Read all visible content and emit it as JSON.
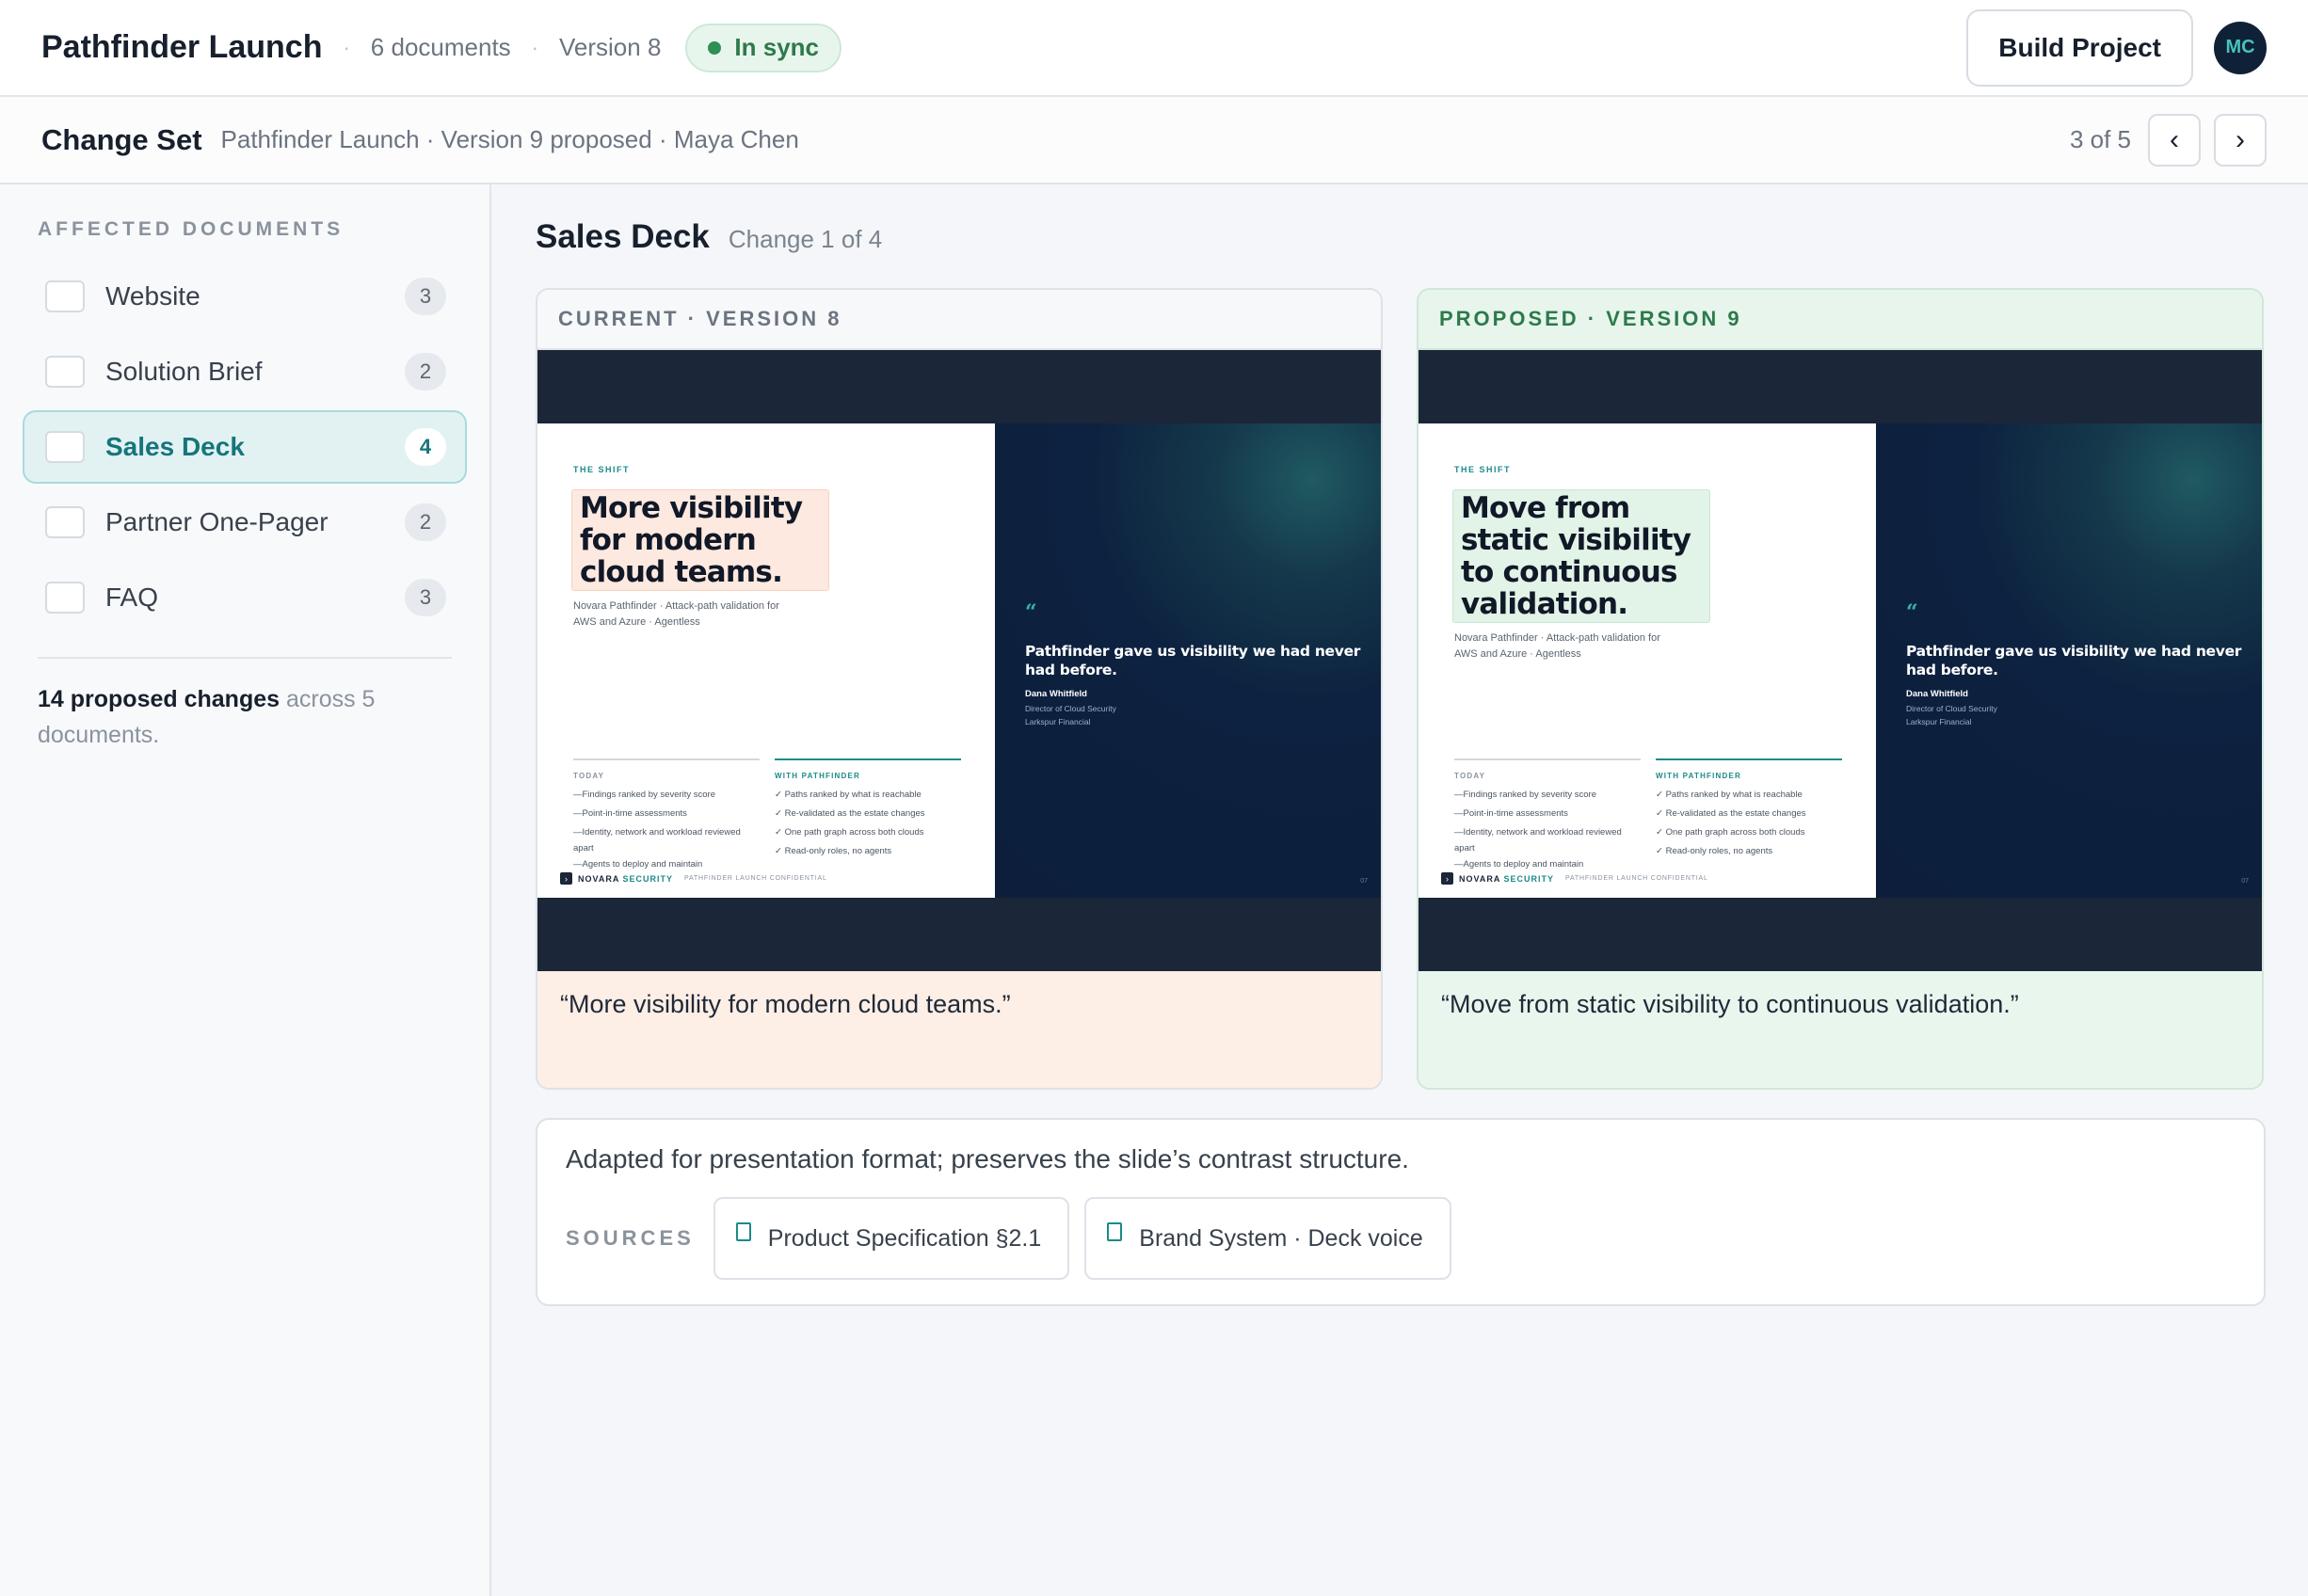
{
  "topbar": {
    "title": "Pathfinder Launch",
    "doc_count": "6 documents",
    "version": "Version 8",
    "sync_status": "In sync",
    "build_label": "Build Project",
    "avatar_initials": "MC"
  },
  "changeset": {
    "title": "Change Set",
    "subtitle": "Pathfinder Launch · Version 9 proposed · Maya Chen",
    "position": "3 of 5",
    "prev_icon": "‹",
    "next_icon": "›"
  },
  "sidebar": {
    "heading": "AFFECTED DOCUMENTS",
    "items": [
      {
        "label": "Website",
        "count": "3",
        "active": false
      },
      {
        "label": "Solution Brief",
        "count": "2",
        "active": false
      },
      {
        "label": "Sales Deck",
        "count": "4",
        "active": true
      },
      {
        "label": "Partner One-Pager",
        "count": "2",
        "active": false
      },
      {
        "label": "FAQ",
        "count": "3",
        "active": false
      }
    ],
    "summary_bold": "14 proposed changes",
    "summary_rest": " across 5 documents."
  },
  "main": {
    "title": "Sales Deck",
    "subtitle": "Change 1 of 4",
    "current": {
      "header": "CURRENT · VERSION 8",
      "caption": "“More visibility for modern cloud teams.”",
      "slide": {
        "eyebrow": "THE SHIFT",
        "headline": "More visibility for modern cloud teams.",
        "tagline": "Novara Pathfinder · Attack-path validation for AWS and Azure · Agentless"
      }
    },
    "proposed": {
      "header": "PROPOSED · VERSION 9",
      "caption": "“Move from static visibility to continuous validation.”",
      "slide": {
        "eyebrow": "THE SHIFT",
        "headline": "Move from static visibility to continuous validation.",
        "tagline": "Novara Pathfinder · Attack-path validation for AWS and Azure · Agentless"
      }
    },
    "slide_common": {
      "today_head": "TODAY",
      "today_items": [
        "—Findings ranked by severity score",
        "—Point-in-time assessments",
        "—Identity, network and workload reviewed",
        "  apart",
        "—Agents to deploy and maintain"
      ],
      "with_head": "WITH PATHFINDER",
      "with_items": [
        "✓ Paths ranked by what is reachable",
        "✓ Re-validated as the estate changes",
        "✓ One path graph across both clouds",
        "✓ Read-only roles, no agents"
      ],
      "footer_brand_a": "NOVARA",
      "footer_brand_b": " SECURITY",
      "footer_meta": "PATHFINDER LAUNCH   CONFIDENTIAL",
      "quote_mark": "“",
      "quote": "Pathfinder gave us visibility we had never had before.",
      "quote_name": "Dana Whitfield",
      "quote_role_1": "Director of Cloud Security",
      "quote_role_2": "Larkspur Financial",
      "page_num": "07"
    },
    "note": "Adapted for presentation format; preserves the slide’s contrast structure.",
    "sources_label": "SOURCES",
    "sources": [
      "Product Specification §2.1",
      "Brand System · Deck voice"
    ]
  },
  "colors": {
    "accent_teal": "#1b8b89",
    "sync_green": "#2f8f55",
    "current_highlight": "#fde9df",
    "proposed_highlight": "#e2f3e7",
    "slide_dark": "#0c1e3c"
  }
}
